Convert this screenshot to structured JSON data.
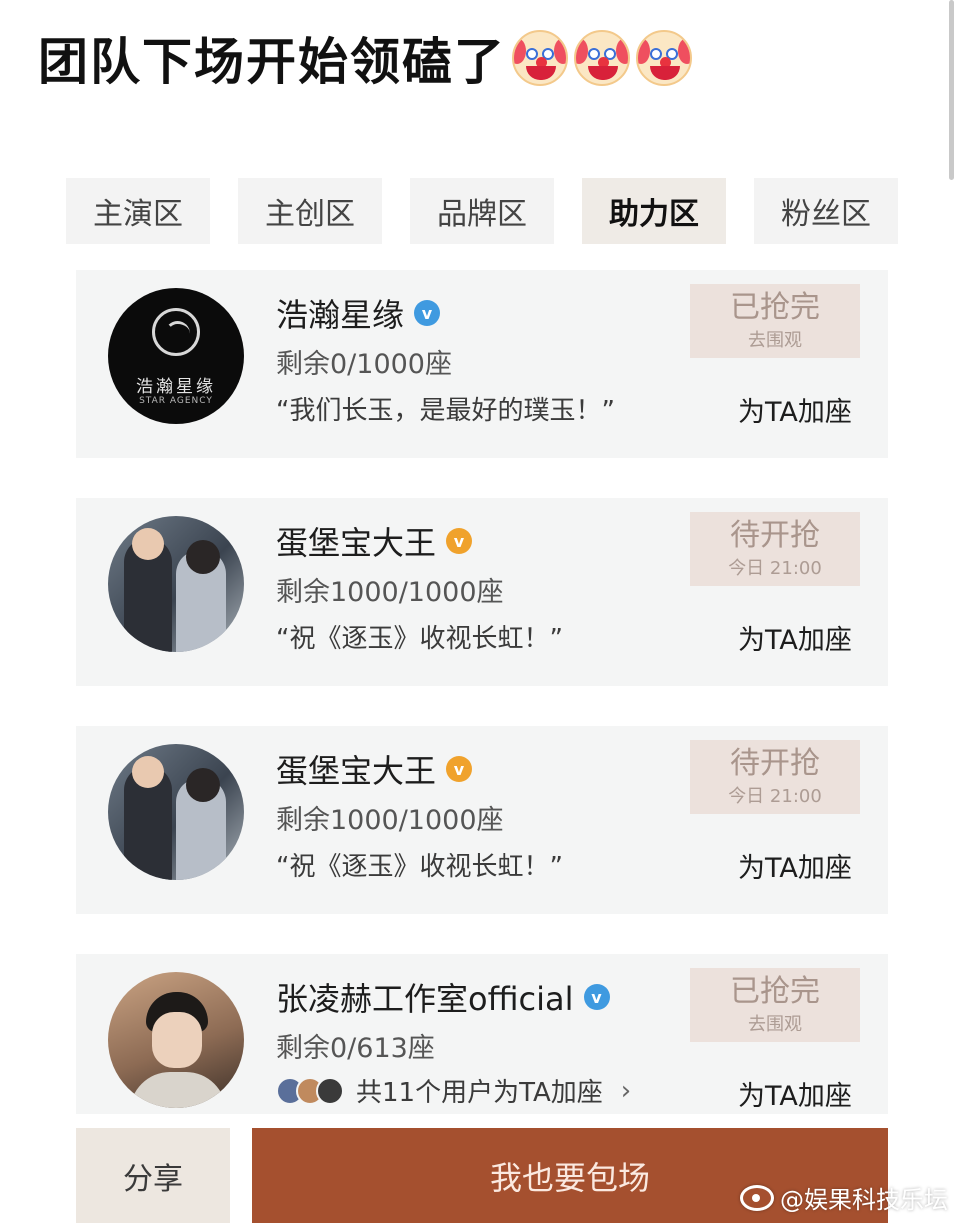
{
  "headline": "团队下场开始领磕了",
  "emoji_icons": [
    "clown-face-icon",
    "clown-face-icon",
    "clown-face-icon"
  ],
  "tabs": [
    {
      "label": "主演区",
      "active": false
    },
    {
      "label": "主创区",
      "active": false
    },
    {
      "label": "品牌区",
      "active": false
    },
    {
      "label": "助力区",
      "active": true
    },
    {
      "label": "粉丝区",
      "active": false
    }
  ],
  "cards": [
    {
      "name": "浩瀚星缘",
      "verified_color": "blue",
      "seats": "剩余0/1000座",
      "quote": "“我们长玉，是最好的璞玉！”",
      "status_main": "已抢完",
      "status_sub": "去围观",
      "action": "为TA加座",
      "avatar_text": "浩瀚星缘",
      "avatar_subtext": "STAR AGENCY"
    },
    {
      "name": "蛋堡宝大王",
      "verified_color": "orange",
      "seats": "剩余1000/1000座",
      "quote": "“祝《逐玉》收视长虹！”",
      "status_main": "待开抢",
      "status_sub": "今日 21:00",
      "action": "为TA加座"
    },
    {
      "name": "蛋堡宝大王",
      "verified_color": "orange",
      "seats": "剩余1000/1000座",
      "quote": "“祝《逐玉》收视长虹！”",
      "status_main": "待开抢",
      "status_sub": "今日 21:00",
      "action": "为TA加座"
    },
    {
      "name": "张凌赫工作室official",
      "verified_color": "blue",
      "seats": "剩余0/613座",
      "users_text": "共11个用户为TA加座",
      "status_main": "已抢完",
      "status_sub": "去围观",
      "action": "为TA加座"
    }
  ],
  "bottom": {
    "share_label": "分享",
    "book_label": "我也要包场"
  },
  "watermark": "@娱果科技乐坛",
  "colors": {
    "primary_button": "#a5502f",
    "status_bg": "#ece1dc",
    "verified_blue": "#3f9ae0",
    "verified_orange": "#f0a22c"
  }
}
